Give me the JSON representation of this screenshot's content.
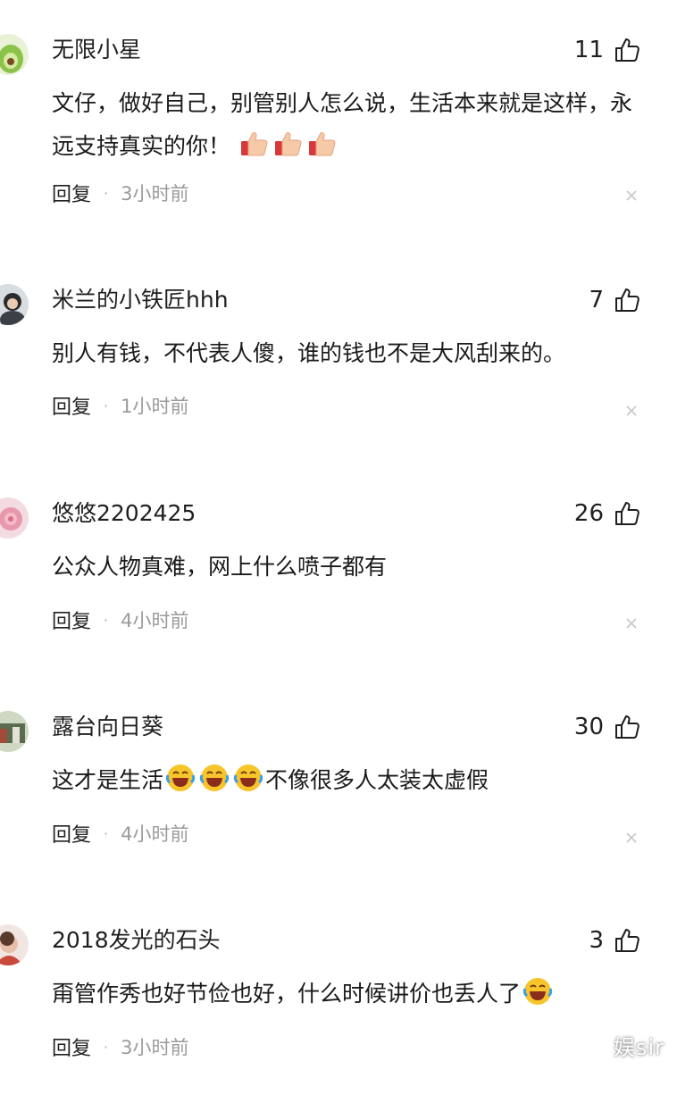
{
  "comments": [
    {
      "username": "无限小星",
      "likes": "11",
      "text_parts": [
        "文仔，做好自己，别管别人怎么说，生活本来就是这样，永远支持真实的你！"
      ],
      "emojis": [
        "thumbs-up-emoji",
        "thumbs-up-emoji",
        "thumbs-up-emoji"
      ],
      "reply_label": "回复",
      "time": "3小时前"
    },
    {
      "username": "米兰的小铁匠hhh",
      "likes": "7",
      "text_parts": [
        "别人有钱，不代表人傻，谁的钱也不是大风刮来的。"
      ],
      "reply_label": "回复",
      "time": "1小时前"
    },
    {
      "username": "悠悠2202425",
      "likes": "26",
      "text_parts": [
        "公众人物真难，网上什么喷子都有"
      ],
      "reply_label": "回复",
      "time": "4小时前"
    },
    {
      "username": "露台向日葵",
      "likes": "30",
      "text_parts": [
        "这才是生活",
        "不像很多人太装太虚假"
      ],
      "emojis": [
        "laughing-crying-emoji",
        "laughing-crying-emoji",
        "laughing-crying-emoji"
      ],
      "reply_label": "回复",
      "time": "4小时前"
    },
    {
      "username": "2018发光的石头",
      "likes": "3",
      "text_parts": [
        "甭管作秀也好节俭也好，什么时候讲价也丢人了"
      ],
      "emojis": [
        "laughing-crying-emoji"
      ],
      "reply_label": "回复",
      "time": "3小时前"
    }
  ],
  "watermark": "娱sir",
  "colors": {
    "text": "#1a1a1a",
    "time": "#9a9a9a",
    "close": "#c8c8c8"
  }
}
